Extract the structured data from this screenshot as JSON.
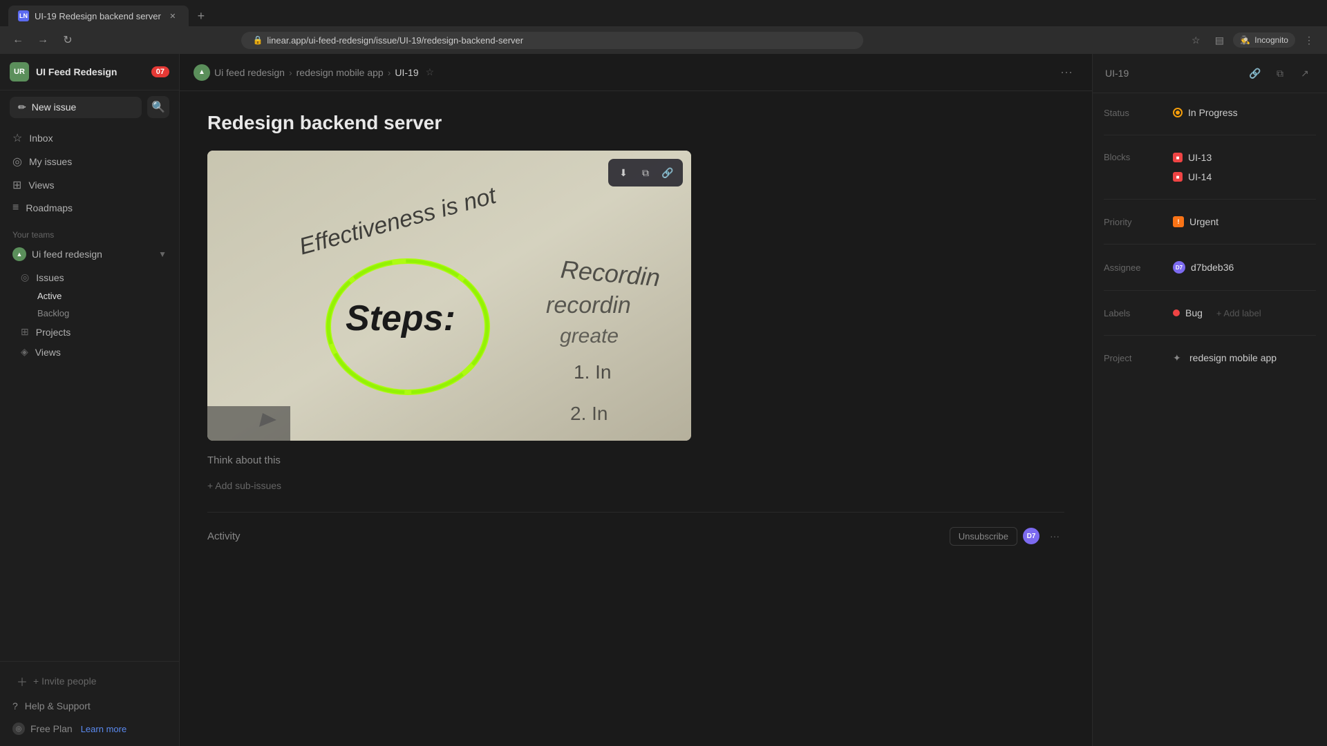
{
  "browser": {
    "tab_title": "UI-19 Redesign backend server",
    "tab_favicon": "LN",
    "url": "linear.app/ui-feed-redesign/issue/UI-19/redesign-backend-server",
    "incognito_label": "Incognito"
  },
  "sidebar": {
    "workspace_initials": "UR",
    "workspace_name": "UI Feed Redesign",
    "notification_count": "07",
    "new_issue_label": "New issue",
    "search_placeholder": "Search",
    "nav_items": [
      {
        "label": "Inbox",
        "icon": "☆"
      },
      {
        "label": "My issues",
        "icon": "◎"
      },
      {
        "label": "Views",
        "icon": "⊞"
      },
      {
        "label": "Roadmaps",
        "icon": "≡"
      }
    ],
    "section_label": "Your teams",
    "team_name": "Ui feed redesign",
    "team_sub_items": [
      {
        "label": "Issues",
        "icon": "◎"
      },
      {
        "label": "Projects",
        "icon": "⊞"
      },
      {
        "label": "Views",
        "icon": "◈"
      }
    ],
    "issues_sub_items": [
      {
        "label": "Active"
      },
      {
        "label": "Backlog"
      }
    ],
    "invite_label": "+ Invite people",
    "help_label": "Help & Support",
    "free_plan_label": "Free Plan",
    "learn_more_label": "Learn more"
  },
  "breadcrumb": {
    "team_icon": "▲",
    "team_label": "Ui feed redesign",
    "project_label": "redesign mobile app",
    "issue_id": "UI-19"
  },
  "issue": {
    "title": "Redesign backend server",
    "think_text": "Think about this",
    "add_sub_issues": "+ Add sub-issues",
    "activity_title": "Activity",
    "unsubscribe_label": "Unsubscribe",
    "image_alt": "Steps text with green circle highlight"
  },
  "right_panel": {
    "issue_id": "UI-19",
    "status_label": "Status",
    "status_value": "In Progress",
    "blocks_label": "Blocks",
    "block1": "UI-13",
    "block2": "UI-14",
    "priority_label": "Priority",
    "priority_value": "Urgent",
    "assignee_label": "Assignee",
    "assignee_value": "d7bdeb36",
    "labels_label": "Labels",
    "bug_label": "Bug",
    "add_label": "+ Add label",
    "project_label": "Project",
    "project_value": "redesign mobile app"
  }
}
